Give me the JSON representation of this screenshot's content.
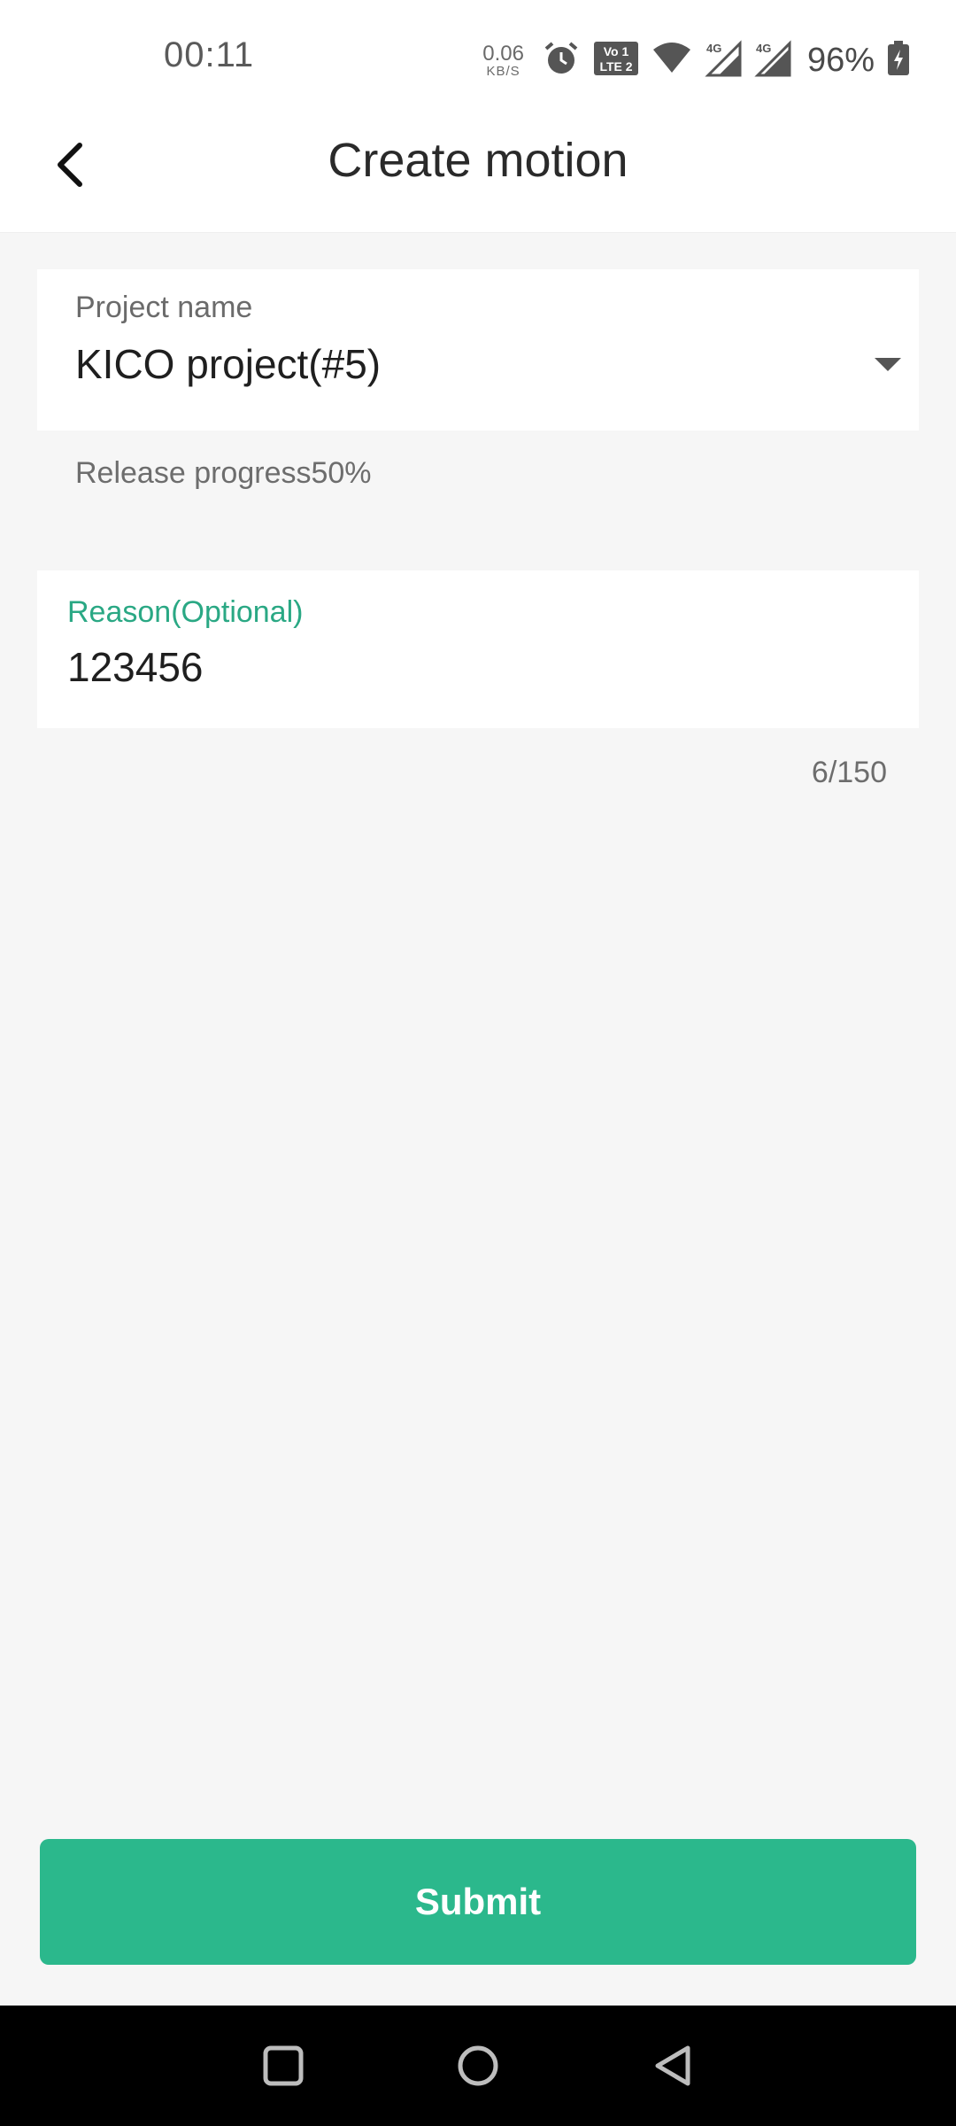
{
  "status_bar": {
    "time": "00:11",
    "net_speed_value": "0.06",
    "net_speed_unit": "KB/S",
    "volte_text": "Vo LTE 2",
    "signal1_label": "4G",
    "signal2_label": "4G",
    "battery": "96%",
    "icons": [
      "alarm-icon",
      "volte-icon",
      "wifi-icon",
      "signal-4g-icon",
      "signal-4g-icon",
      "battery-charging-icon"
    ]
  },
  "app_bar": {
    "title": "Create motion",
    "back_icon": "back-arrow-icon"
  },
  "form": {
    "project_label": "Project name",
    "project_value": "KICO project(#5)",
    "release_progress_text": "Release progress50%",
    "release_progress_percent": 50,
    "reason_label": "Reason(Optional)",
    "reason_value": "123456",
    "reason_counter": "6/150"
  },
  "submit_label": "Submit",
  "colors": {
    "accent": "#2bb88c",
    "accent_label": "#2aa884",
    "background": "#f6f6f6"
  },
  "nav_bar": {
    "icons": [
      "recents-square-icon",
      "home-circle-icon",
      "back-triangle-icon"
    ]
  }
}
